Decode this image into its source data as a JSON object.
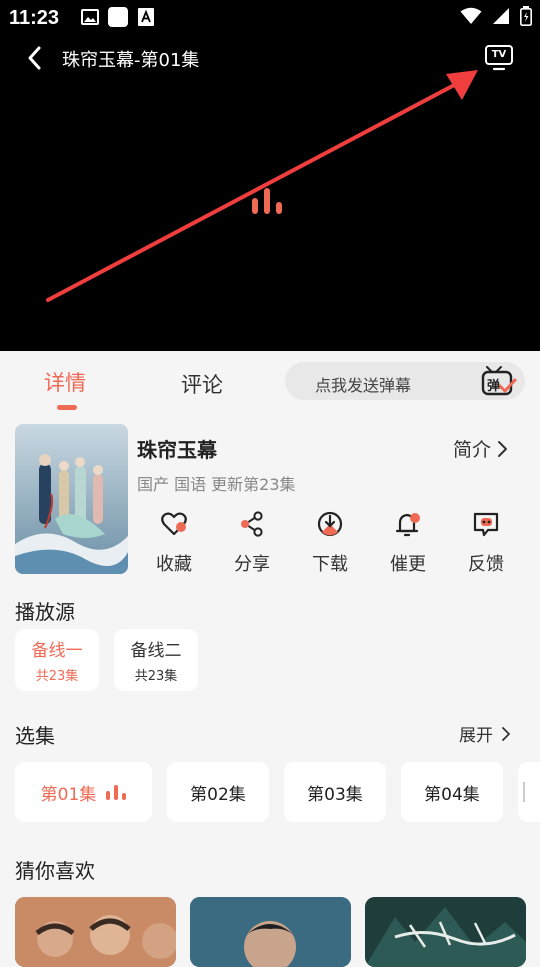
{
  "status": {
    "time": "11:23"
  },
  "player": {
    "title": "珠帘玉幕-第01集",
    "tv_icon_label": "TV"
  },
  "tabs": [
    {
      "label": "详情",
      "active": true
    },
    {
      "label": "评论",
      "active": false
    }
  ],
  "danmu": {
    "placeholder": "点我发送弹幕",
    "icon_char": "弹"
  },
  "show": {
    "title": "珠帘玉幕",
    "intro_label": "简介",
    "meta": "国产 国语 更新第23集",
    "actions": [
      {
        "label": "收藏",
        "icon": "heart-icon"
      },
      {
        "label": "分享",
        "icon": "share-icon"
      },
      {
        "label": "下载",
        "icon": "download-icon"
      },
      {
        "label": "催更",
        "icon": "bell-icon"
      },
      {
        "label": "反馈",
        "icon": "feedback-icon"
      }
    ]
  },
  "sources": {
    "title": "播放源",
    "items": [
      {
        "name": "备线一",
        "count": "共23集",
        "active": true
      },
      {
        "name": "备线二",
        "count": "共23集",
        "active": false
      }
    ]
  },
  "episodes": {
    "title": "选集",
    "expand_label": "展开",
    "items": [
      {
        "label": "第01集",
        "active": true
      },
      {
        "label": "第02集",
        "active": false
      },
      {
        "label": "第03集",
        "active": false
      },
      {
        "label": "第04集",
        "active": false
      }
    ]
  },
  "recommend": {
    "title": "猜你喜欢"
  },
  "colors": {
    "accent": "#ef6a55",
    "background": "#f5f5f5",
    "player": "#000000"
  }
}
